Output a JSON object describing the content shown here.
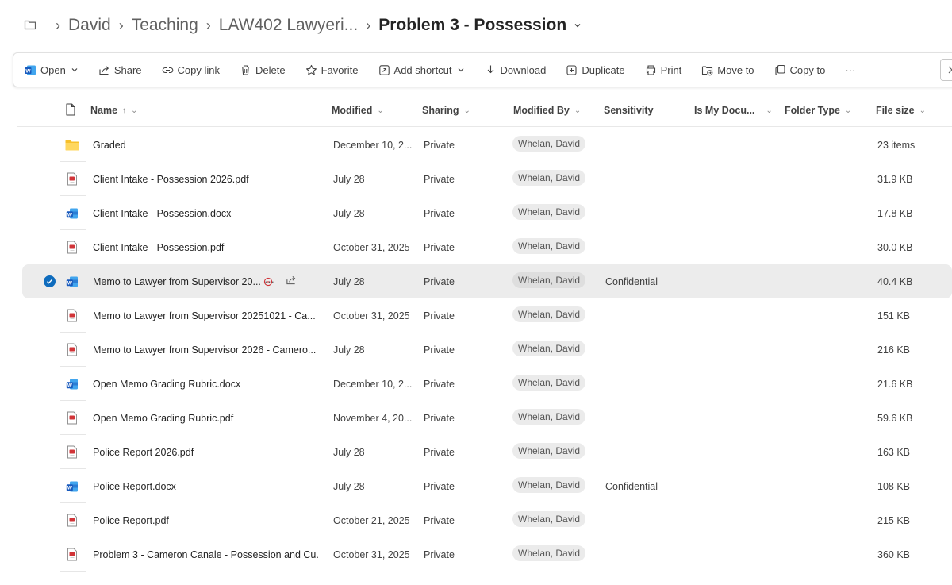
{
  "breadcrumb": {
    "items": [
      "David",
      "Teaching",
      "LAW402 Lawyeri..."
    ],
    "current": "Problem 3 - Possession",
    "separator": "›"
  },
  "toolbar": {
    "open": "Open",
    "share": "Share",
    "copy_link": "Copy link",
    "delete": "Delete",
    "favorite": "Favorite",
    "add_shortcut": "Add shortcut",
    "download": "Download",
    "duplicate": "Duplicate",
    "print": "Print",
    "move_to": "Move to",
    "copy_to": "Copy to",
    "more": "···"
  },
  "columns": {
    "name": "Name",
    "name_sort": "↑",
    "modified": "Modified",
    "sharing": "Sharing",
    "modified_by": "Modified By",
    "sensitivity": "Sensitivity",
    "is_my_doc": "Is My Docu...",
    "folder_type": "Folder Type",
    "file_size": "File size"
  },
  "files": [
    {
      "type": "folder",
      "name": "Graded",
      "modified": "December 10, 2...",
      "sharing": "Private",
      "by": "Whelan, David",
      "sensitivity": "",
      "size": "23 items",
      "selected": false
    },
    {
      "type": "pdf",
      "name": "Client Intake - Possession 2026.pdf",
      "modified": "July 28",
      "sharing": "Private",
      "by": "Whelan, David",
      "sensitivity": "",
      "size": "31.9 KB",
      "selected": false
    },
    {
      "type": "word",
      "name": "Client Intake - Possession.docx",
      "modified": "July 28",
      "sharing": "Private",
      "by": "Whelan, David",
      "sensitivity": "",
      "size": "17.8 KB",
      "selected": false
    },
    {
      "type": "pdf",
      "name": "Client Intake - Possession.pdf",
      "modified": "October 31, 2025",
      "sharing": "Private",
      "by": "Whelan, David",
      "sensitivity": "",
      "size": "30.0 KB",
      "selected": false
    },
    {
      "type": "word",
      "name": "Memo to Lawyer from Supervisor 20...",
      "modified": "July 28",
      "sharing": "Private",
      "by": "Whelan, David",
      "sensitivity": "Confidential",
      "size": "40.4 KB",
      "selected": true
    },
    {
      "type": "pdf",
      "name": "Memo to Lawyer from Supervisor 20251021 - Ca...",
      "modified": "October 31, 2025",
      "sharing": "Private",
      "by": "Whelan, David",
      "sensitivity": "",
      "size": "151 KB",
      "selected": false
    },
    {
      "type": "pdf",
      "name": "Memo to Lawyer from Supervisor 2026 - Camero...",
      "modified": "July 28",
      "sharing": "Private",
      "by": "Whelan, David",
      "sensitivity": "",
      "size": "216 KB",
      "selected": false
    },
    {
      "type": "word",
      "name": "Open Memo Grading Rubric.docx",
      "modified": "December 10, 2...",
      "sharing": "Private",
      "by": "Whelan, David",
      "sensitivity": "",
      "size": "21.6 KB",
      "selected": false
    },
    {
      "type": "pdf",
      "name": "Open Memo Grading Rubric.pdf",
      "modified": "November 4, 20...",
      "sharing": "Private",
      "by": "Whelan, David",
      "sensitivity": "",
      "size": "59.6 KB",
      "selected": false
    },
    {
      "type": "pdf",
      "name": "Police Report 2026.pdf",
      "modified": "July 28",
      "sharing": "Private",
      "by": "Whelan, David",
      "sensitivity": "",
      "size": "163 KB",
      "selected": false
    },
    {
      "type": "word",
      "name": "Police Report.docx",
      "modified": "July 28",
      "sharing": "Private",
      "by": "Whelan, David",
      "sensitivity": "Confidential",
      "size": "108 KB",
      "selected": false
    },
    {
      "type": "pdf",
      "name": "Police Report.pdf",
      "modified": "October 21, 2025",
      "sharing": "Private",
      "by": "Whelan, David",
      "sensitivity": "",
      "size": "215 KB",
      "selected": false
    },
    {
      "type": "pdf",
      "name": "Problem 3 - Cameron Canale - Possession and Cu...",
      "modified": "October 31, 2025",
      "sharing": "Private",
      "by": "Whelan, David",
      "sensitivity": "",
      "size": "360 KB",
      "selected": false
    }
  ],
  "row_actions": {
    "more": "···"
  },
  "icons": {
    "folder": "folder-icon",
    "pdf": "pdf-file-icon",
    "word": "word-file-icon"
  },
  "colors": {
    "accent": "#0f6cbd",
    "folder": "#f7c02b",
    "pdf": "#d13438",
    "word": "#185abd",
    "selected_row": "#ececec"
  }
}
